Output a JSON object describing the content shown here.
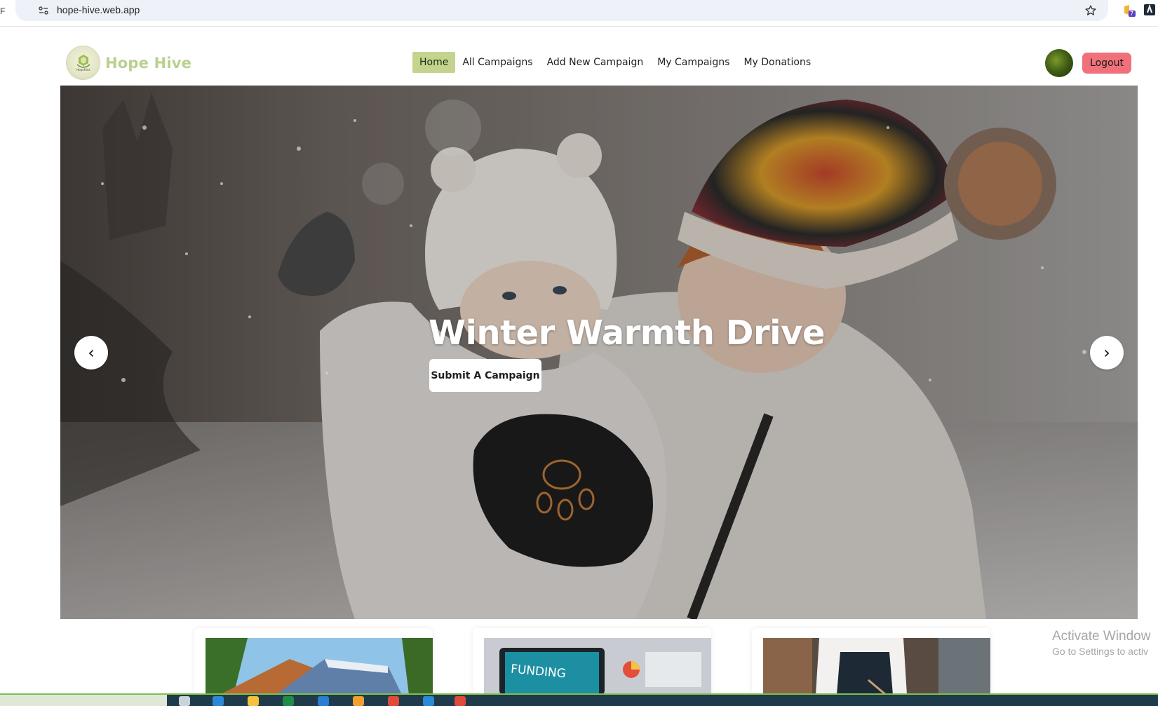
{
  "browser": {
    "url": "hope-hive.web.app",
    "left_edge_glyph": "F",
    "extension_badge": "7"
  },
  "navbar": {
    "brand": "Hope Hive",
    "logo_text": "HopeHive",
    "links": [
      {
        "label": "Home",
        "active": true
      },
      {
        "label": "All Campaigns",
        "active": false
      },
      {
        "label": "Add New Campaign",
        "active": false
      },
      {
        "label": "My Campaigns",
        "active": false
      },
      {
        "label": "My Donations",
        "active": false
      }
    ],
    "logout_label": "Logout"
  },
  "hero": {
    "title": "Winter Warmth Drive",
    "button_label": "Submit A Campaign",
    "prev_glyph": "‹",
    "next_glyph": "›"
  },
  "cards": [
    {
      "image": "cabin-in-forest"
    },
    {
      "image": "funding-laptop",
      "image_text": "FUNDING"
    },
    {
      "image": "shop-worker"
    }
  ],
  "watermark": {
    "line1": "Activate Window",
    "line2": "Go to Settings to activ"
  },
  "colors": {
    "brand": "#b9d08f",
    "nav_active": "#c4d48f",
    "logout": "#f0717a"
  }
}
